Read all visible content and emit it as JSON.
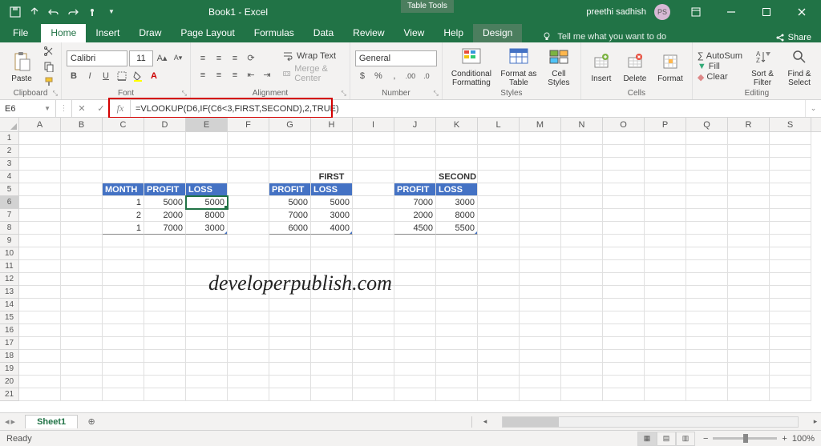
{
  "titlebar": {
    "doc_title": "Book1 - Excel",
    "context_group": "Table Tools",
    "user_name": "preethi sadhish",
    "avatar_initials": "PS"
  },
  "tabs": {
    "file": "File",
    "home": "Home",
    "insert": "Insert",
    "draw": "Draw",
    "page_layout": "Page Layout",
    "formulas": "Formulas",
    "data": "Data",
    "review": "Review",
    "view": "View",
    "help": "Help",
    "design": "Design",
    "tell_me": "Tell me what you want to do",
    "share": "Share"
  },
  "ribbon": {
    "clipboard": {
      "paste": "Paste",
      "label": "Clipboard"
    },
    "font": {
      "name": "Calibri",
      "size": "11",
      "label": "Font"
    },
    "alignment": {
      "wrap": "Wrap Text",
      "merge": "Merge & Center",
      "label": "Alignment"
    },
    "number": {
      "format": "General",
      "label": "Number"
    },
    "styles": {
      "cond": "Conditional Formatting",
      "table": "Format as Table",
      "cell": "Cell Styles",
      "label": "Styles"
    },
    "cells": {
      "insert": "Insert",
      "delete": "Delete",
      "format": "Format",
      "label": "Cells"
    },
    "editing": {
      "autosum": "AutoSum",
      "fill": "Fill",
      "clear": "Clear",
      "sort": "Sort & Filter",
      "find": "Find & Select",
      "label": "Editing"
    }
  },
  "formula_bar": {
    "cell_ref": "E6",
    "formula": "=VLOOKUP(D6,IF(C6<3,FIRST,SECOND),2,TRUE)"
  },
  "columns": [
    "A",
    "B",
    "C",
    "D",
    "E",
    "F",
    "G",
    "H",
    "I",
    "J",
    "K",
    "L",
    "M",
    "N",
    "O",
    "P",
    "Q",
    "R",
    "S"
  ],
  "row_numbers": [
    "1",
    "2",
    "3",
    "4",
    "5",
    "6",
    "7",
    "8",
    "9",
    "10",
    "11",
    "12",
    "13",
    "14",
    "15",
    "16",
    "17",
    "18",
    "19",
    "20",
    "21"
  ],
  "sheet": {
    "first_label": "FIRST",
    "second_label": "SECOND",
    "t1_headers": [
      "MONTH",
      "PROFIT",
      "LOSS"
    ],
    "t2_headers": [
      "PROFIT",
      "LOSS"
    ],
    "t3_headers": [
      "PROFIT",
      "LOSS"
    ],
    "t1": [
      [
        "1",
        "5000",
        "5000"
      ],
      [
        "2",
        "2000",
        "8000"
      ],
      [
        "1",
        "7000",
        "3000"
      ]
    ],
    "t2": [
      [
        "5000",
        "5000"
      ],
      [
        "7000",
        "3000"
      ],
      [
        "6000",
        "4000"
      ]
    ],
    "t3": [
      [
        "7000",
        "3000"
      ],
      [
        "2000",
        "8000"
      ],
      [
        "4500",
        "5500"
      ]
    ]
  },
  "watermark": "developerpublish.com",
  "sheet_tabs": {
    "tab1": "Sheet1"
  },
  "status": {
    "ready": "Ready",
    "zoom": "100%"
  }
}
